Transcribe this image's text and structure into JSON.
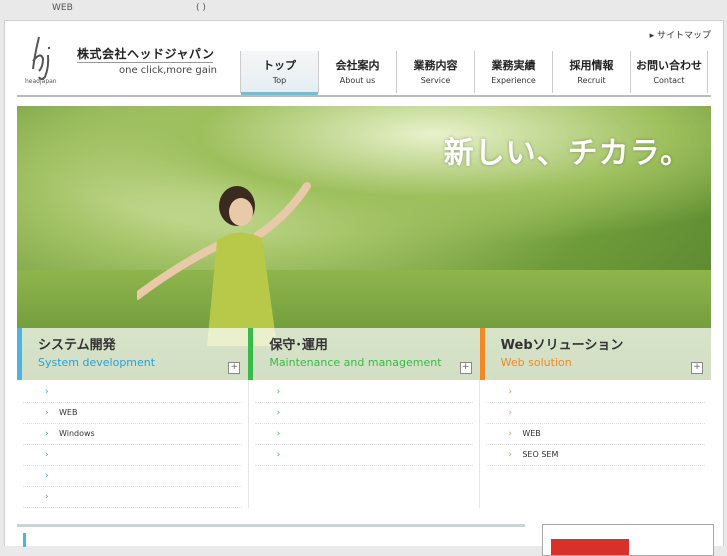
{
  "topbar": {
    "text1": "WEB",
    "text2": "( )"
  },
  "header": {
    "company_name": "株式会社ヘッドジャパン",
    "tagline": "one click,more gain",
    "sitemap_link": "▸ サイトマップ"
  },
  "nav": [
    {
      "jp": "トップ",
      "en": "Top"
    },
    {
      "jp": "会社案内",
      "en": "About us"
    },
    {
      "jp": "業務内容",
      "en": "Service"
    },
    {
      "jp": "業務実績",
      "en": "Experience"
    },
    {
      "jp": "採用情報",
      "en": "Recruit"
    },
    {
      "jp": "お問い合わせ",
      "en": "Contact"
    }
  ],
  "hero": {
    "headline": "新しい、チカラ。"
  },
  "panels": [
    {
      "jp": "システム開発",
      "en": "System development"
    },
    {
      "jp": "保守･運用",
      "en": "Maintenance and management"
    },
    {
      "jp": "Webソリューション",
      "en": "Web solution"
    }
  ],
  "columns": [
    [
      "",
      "WEB",
      "Windows",
      "",
      "",
      ""
    ],
    [
      "",
      "",
      "",
      ""
    ],
    [
      "",
      "",
      "WEB",
      "SEO SEM"
    ]
  ],
  "colors": {
    "accent": "#77bcd0",
    "blue": "#2aa0d8",
    "green": "#3ab84a",
    "orange": "#ee8a2a"
  },
  "icons": {
    "arrow": "chevron-right-icon",
    "plus": "plus-box-icon"
  }
}
